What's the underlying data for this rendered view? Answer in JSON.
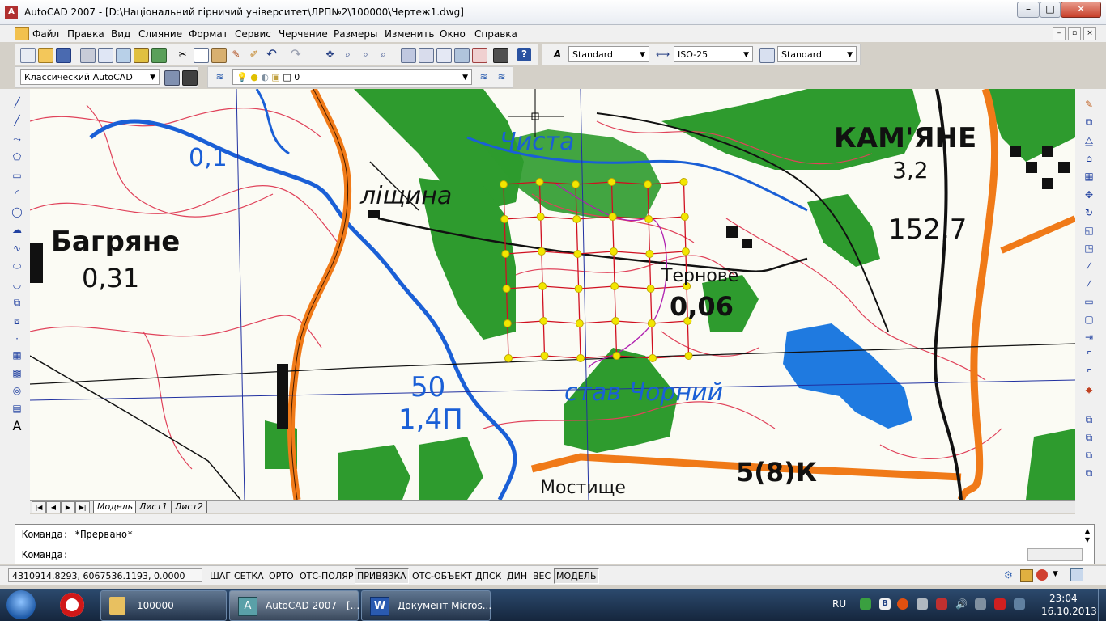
{
  "window": {
    "title": "AutoCAD 2007 - [D:\\Національний гірничий університет\\ЛРП№2\\100000\\Чертеж1.dwg]",
    "icon": "autocad-icon",
    "controls": {
      "minimize": "–",
      "maximize": "□",
      "close": "✕"
    }
  },
  "menu": {
    "items": [
      "Файл",
      "Правка",
      "Вид",
      "Слияние",
      "Формат",
      "Сервис",
      "Черчение",
      "Размеры",
      "Изменить",
      "Окно",
      "Справка"
    ]
  },
  "toolbars": {
    "text_style": "Standard",
    "dim_style": "ISO-25",
    "table_style": "Standard",
    "workspace": "Классический AutoCAD",
    "layer": "0"
  },
  "map": {
    "labels": {
      "chysta": "Чиста",
      "kamiane": "КАМ'ЯНЕ",
      "kamiane_val": "3,2",
      "lishchyna": "ліщина",
      "bahriane": "Багряне",
      "bahriane_val": "0,31",
      "val_01": "0,1",
      "ternove": "Тернове",
      "ternove_val": "0,06",
      "height": "152,7",
      "bridge_top": "50",
      "bridge_bottom": "1,4П",
      "pond": "став Чорний",
      "road": "5(8)К",
      "mostyshche": "Мостище"
    }
  },
  "layout_tabs": {
    "model": "Модель",
    "sheet1": "Лист1",
    "sheet2": "Лист2"
  },
  "command": {
    "history": "Команда: *Прервано*",
    "prompt": "Команда:"
  },
  "status": {
    "coordinates": "4310914.8293, 6067536.1193, 0.0000",
    "buttons": [
      {
        "label": "ШАГ",
        "on": false
      },
      {
        "label": "СЕТКА",
        "on": false
      },
      {
        "label": "ОРТО",
        "on": false
      },
      {
        "label": "ОТС-ПОЛЯР",
        "on": false
      },
      {
        "label": "ПРИВЯЗКА",
        "on": true
      },
      {
        "label": "ОТС-ОБЪЕКТ",
        "on": false
      },
      {
        "label": "ДПСК",
        "on": false
      },
      {
        "label": "ДИН",
        "on": false
      },
      {
        "label": "ВЕС",
        "on": false
      },
      {
        "label": "МОДЕЛЬ",
        "on": true
      }
    ]
  },
  "taskbar": {
    "items": [
      {
        "label": "100000",
        "icon": "folder-icon"
      },
      {
        "label": "AutoCAD 2007 - [...",
        "icon": "autocad-icon"
      },
      {
        "label": "Документ Micros...",
        "icon": "word-icon"
      }
    ],
    "language": "RU",
    "time": "23:04",
    "date": "16.10.2013"
  },
  "colors": {
    "forest": "#2e9b2e",
    "river": "#1a5fd6",
    "road": "#f07a18",
    "contour": "#e0425a",
    "grid": "#d01020",
    "grid_point": "#f2e600"
  }
}
